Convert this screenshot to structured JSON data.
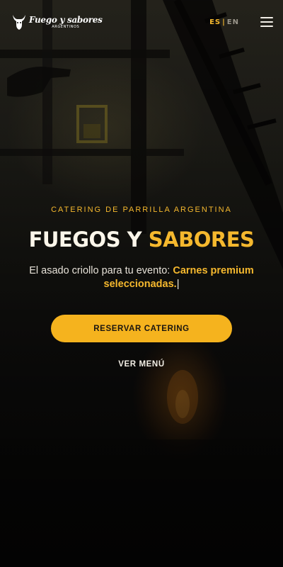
{
  "header": {
    "logo_text": "Fuego y sabores",
    "logo_subtext": "ARGENTINOS",
    "lang_es": "ES",
    "lang_separator": "|",
    "lang_en": "EN"
  },
  "hero": {
    "eyebrow": "CATERING DE PARRILLA ARGENTINA",
    "title_part1": "FUEGOS Y ",
    "title_part2": "SABORES",
    "subtitle_plain": "El asado criollo para tu evento: ",
    "subtitle_highlight": "Carnes premium seleccionadas.",
    "subtitle_cursor": "|",
    "cta_label": "RESERVAR CATERING",
    "secondary_label": "VER MENÚ"
  },
  "colors": {
    "accent": "#f5b82e",
    "button": "#f5b31e",
    "background": "#0b0a08"
  },
  "icons": {
    "logo": "bull-head-icon",
    "menu": "hamburger-menu-icon"
  }
}
